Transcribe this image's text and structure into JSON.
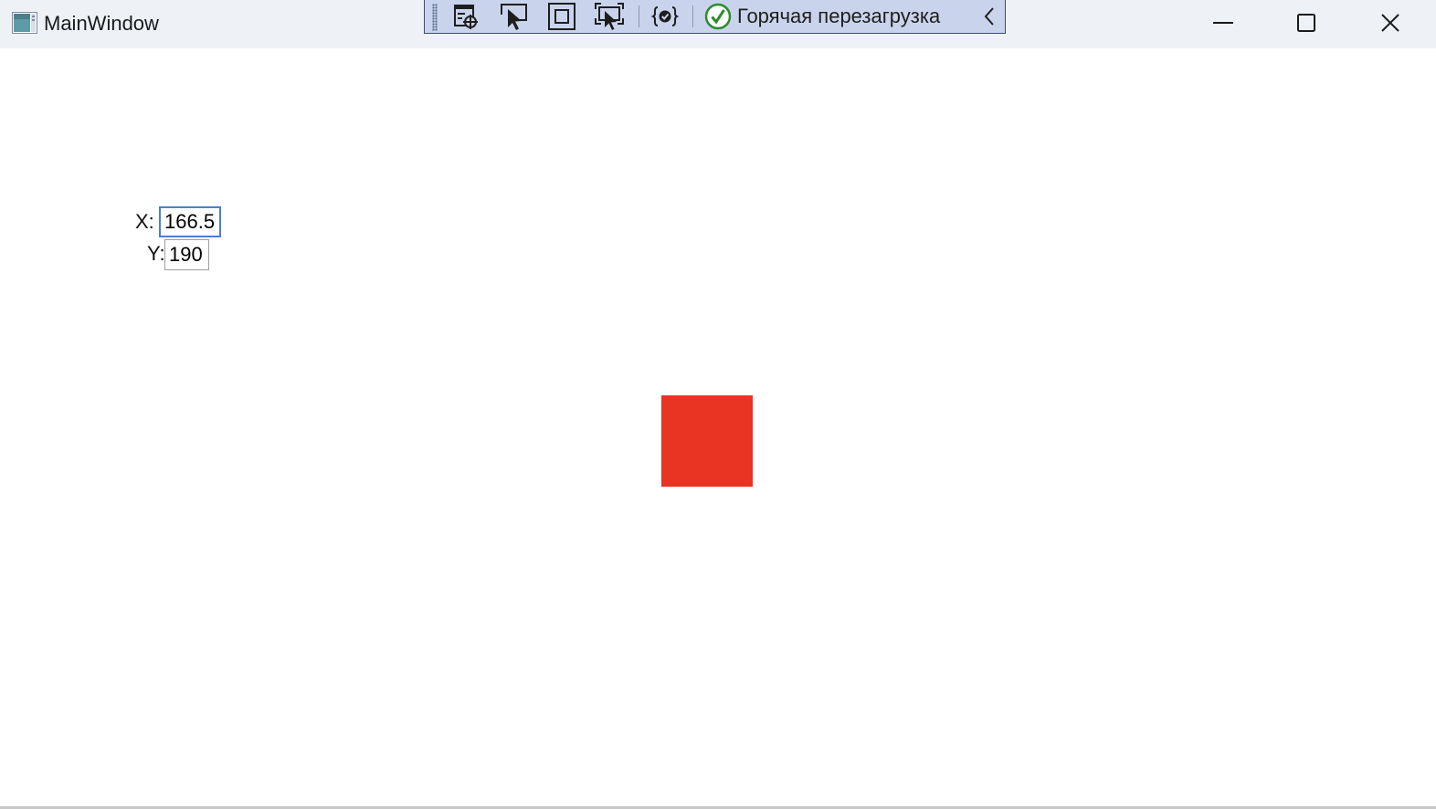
{
  "window": {
    "title": "MainWindow"
  },
  "debug_toolbar": {
    "hot_reload_label": "Горячая перезагрузка",
    "icons": [
      "live-visual-tree-icon",
      "select-element-icon",
      "display-layout-adorners-icon",
      "track-focused-element-icon",
      "binding-failures-icon",
      "hot-reload-status-icon",
      "collapse-chevron-icon"
    ]
  },
  "coords": {
    "x_label": "X:",
    "x_value": "166.5",
    "y_label": "Y:",
    "y_value": "190"
  },
  "colors": {
    "square": "#e93323",
    "focused_border": "#4a7fd4",
    "input_border": "#9e9e9e",
    "titlebar": "#eef2f7",
    "toolbar": "#c9d4ec",
    "hot_reload_ok": "#2e8b2e"
  }
}
